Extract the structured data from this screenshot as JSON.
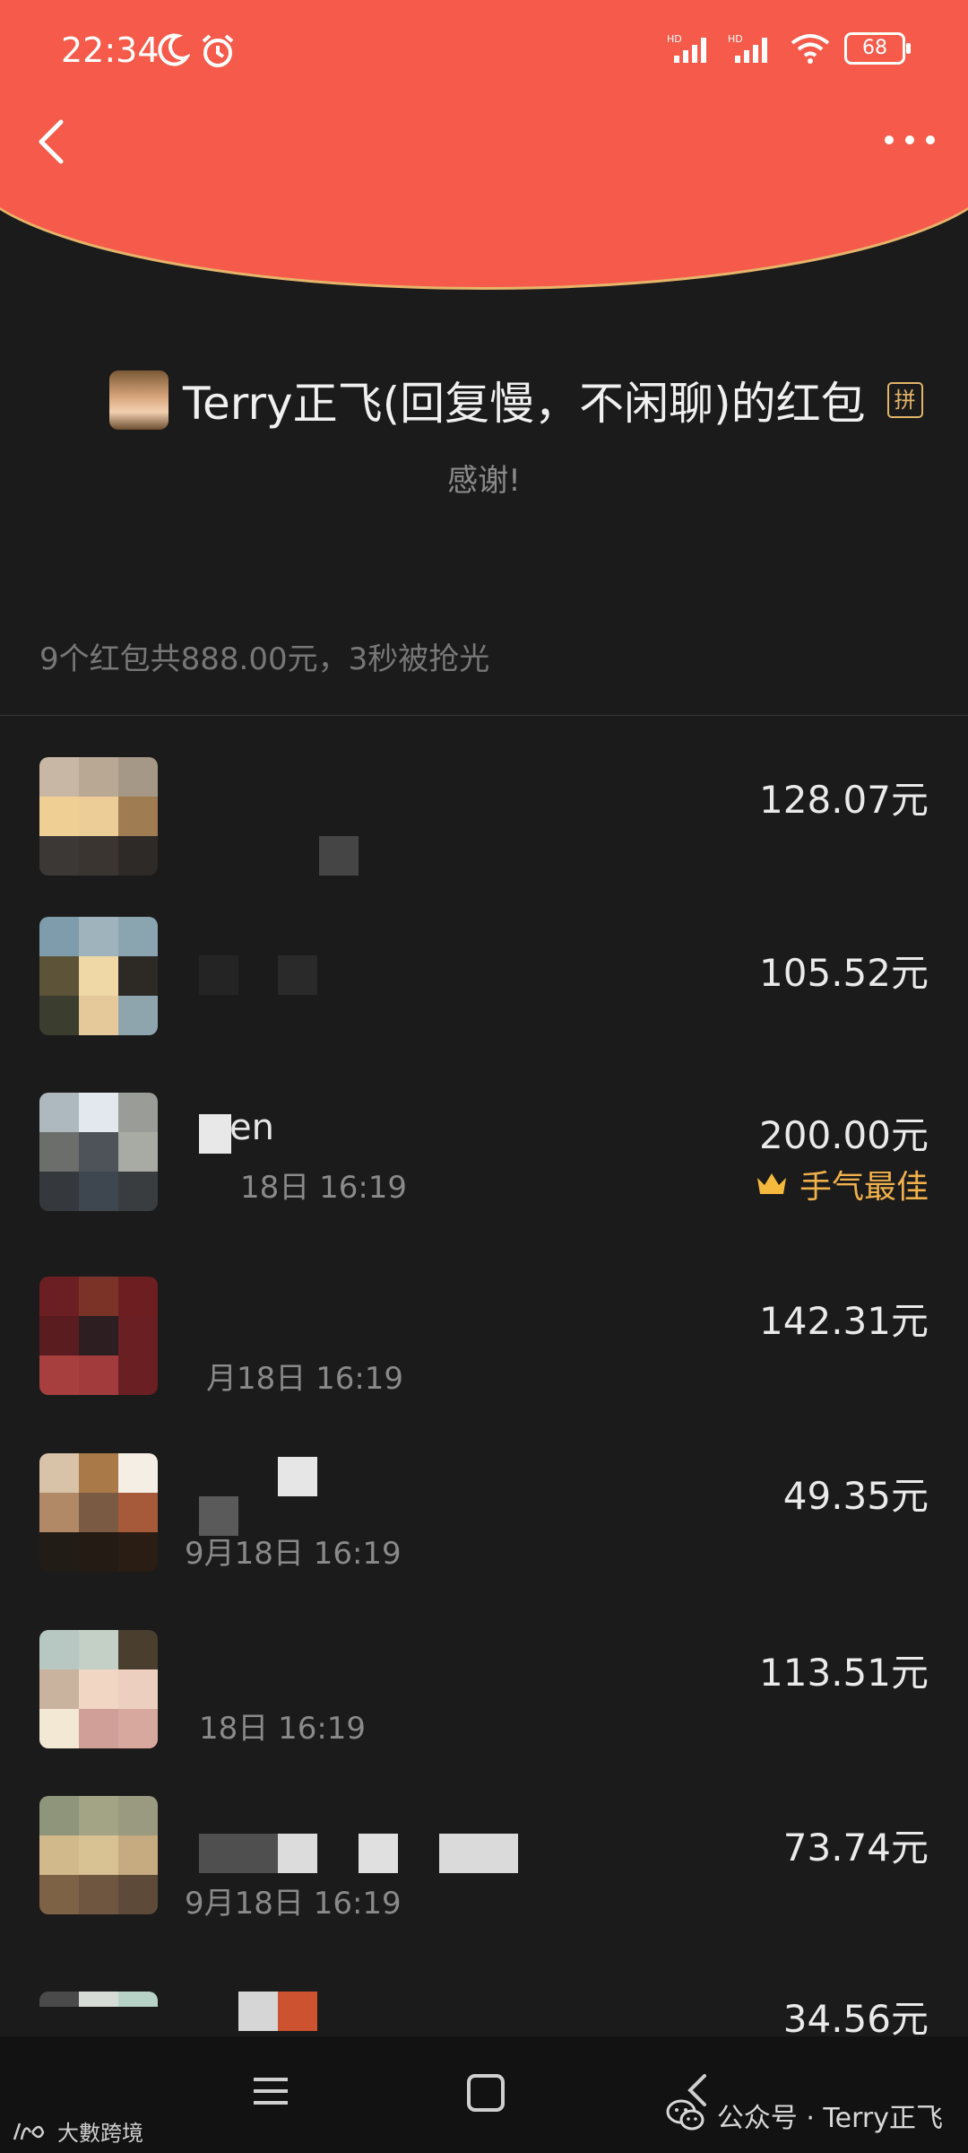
{
  "status_bar": {
    "time": "22:34",
    "battery": "68",
    "icons": [
      "moon-icon",
      "alarm-icon",
      "hd-signal-icon",
      "hd-signal-icon",
      "wifi-icon",
      "battery-icon"
    ]
  },
  "header": {
    "sender_name": "Terry正飞(回复慢，不闲聊)的红包",
    "pin_badge": "拼",
    "blessing": "感谢!",
    "summary": "9个红包共888.00元，3秒被抢光"
  },
  "list": {
    "items": [
      {
        "name": "",
        "time": "",
        "amount": "128.07元",
        "best": ""
      },
      {
        "name": "",
        "time": "",
        "amount": "105.52元",
        "best": ""
      },
      {
        "name": "en",
        "time": "18日  16:19",
        "amount": "200.00元",
        "best": "手气最佳"
      },
      {
        "name": "",
        "time": "月18日  16:19",
        "amount": "142.31元",
        "best": ""
      },
      {
        "name": "",
        "time": "9月18日  16:19",
        "amount": "49.35元",
        "best": ""
      },
      {
        "name": "",
        "time": "18日  16:19",
        "amount": "113.51元",
        "best": ""
      },
      {
        "name": "",
        "time": "9月18日  16:19",
        "amount": "73.74元",
        "best": ""
      },
      {
        "name": "",
        "time": "",
        "amount": "34.56元",
        "best": ""
      }
    ]
  },
  "watermark": {
    "left": "大數跨境",
    "right": "公众号 · Terry正飞"
  },
  "colors": {
    "header_red": "#f55a4a",
    "gold_accent": "#f0b04c",
    "background": "#1b1b1b"
  }
}
